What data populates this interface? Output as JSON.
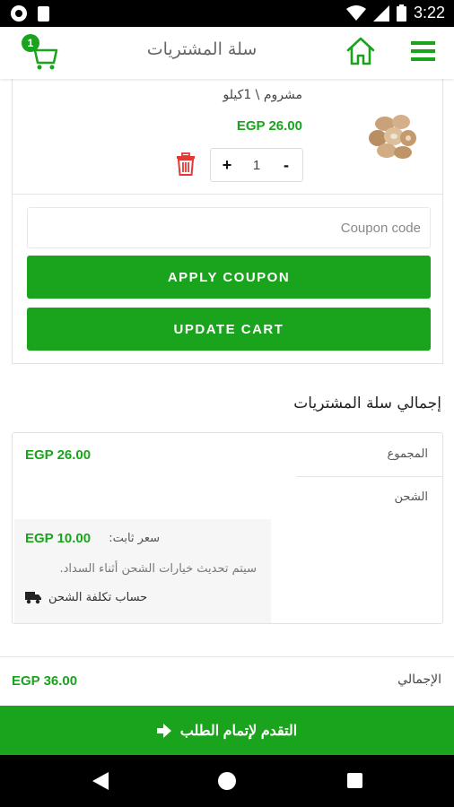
{
  "status_bar": {
    "time": "3:22"
  },
  "app_bar": {
    "title": "سلة المشتريات",
    "cart_count": "1"
  },
  "cart_item": {
    "name": "مشروم \\ 1كيلو",
    "price": "EGP 26.00",
    "quantity": "1",
    "increment_symbol": "+",
    "decrement_symbol": "-"
  },
  "coupon": {
    "placeholder": "Coupon code",
    "apply_label": "APPLY COUPON",
    "update_label": "UPDATE CART"
  },
  "totals": {
    "heading": "إجمالي سلة المشتريات",
    "subtotal_label": "المجموع",
    "subtotal_value": "EGP 26.00",
    "shipping_label": "الشحن",
    "flat_rate_label": "سعر ثابت:",
    "flat_rate_value": "EGP 10.00",
    "shipping_note": "سيتم تحديث خيارات الشحن أثناء السداد.",
    "calculate_shipping": "حساب تكلفة الشحن",
    "total_label": "الإجمالي",
    "total_value": "EGP 36.00"
  },
  "checkout": {
    "label": "التقدم لإتمام الطلب"
  },
  "colors": {
    "accent": "#1aa31c",
    "delete": "#e53935"
  }
}
